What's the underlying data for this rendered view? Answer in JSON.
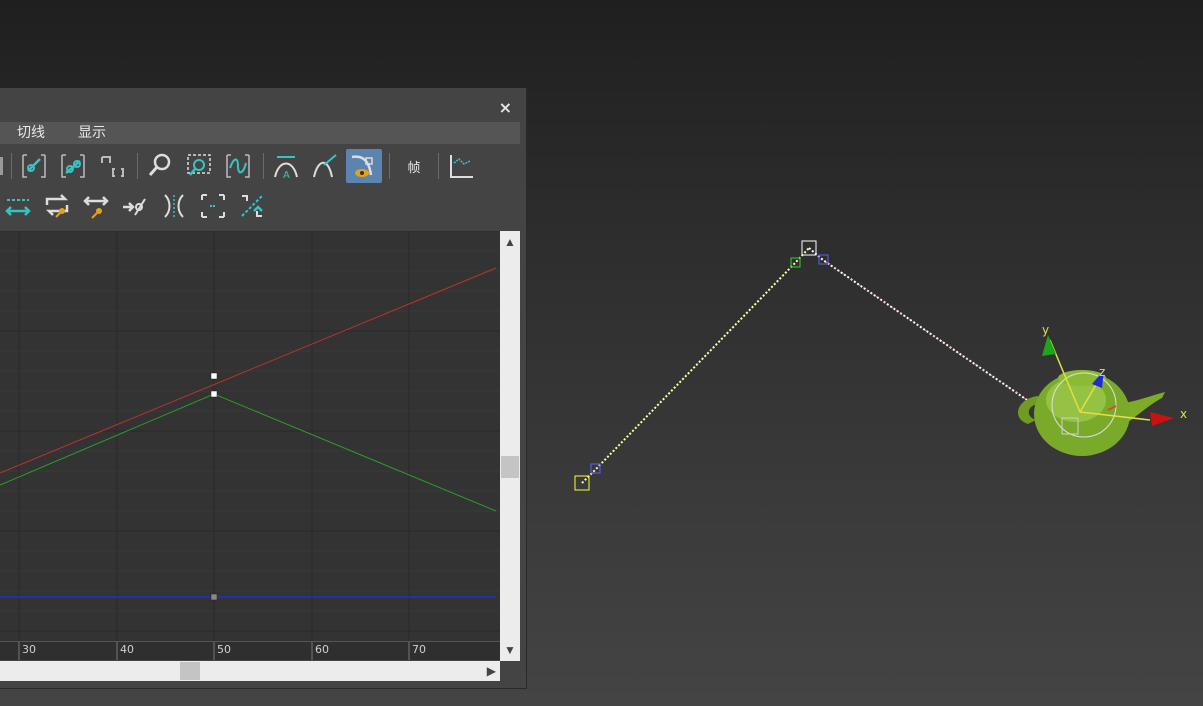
{
  "curve_editor": {
    "close_label": "×",
    "menu": [
      "切线",
      "显示"
    ],
    "frame_button_label": "帧",
    "ruler_ticks": [
      "30",
      "40",
      "50",
      "60",
      "70"
    ],
    "curve_colors": {
      "x": "#c03030",
      "y": "#2e9a2e",
      "z": "#2030b0"
    }
  },
  "scene": {
    "gizmo_axes": {
      "x": "x",
      "y": "y",
      "z": "z"
    },
    "trajectory_colors": {
      "path_a": "#ffff99",
      "path_b": "#ffffff"
    },
    "object": "teapot"
  },
  "toolbar_icons": {
    "row1": [
      "filter-keys-icon",
      "move-keys-icon",
      "slide-keys-icon",
      "zoom-icon",
      "zoom-region-icon",
      "curve-icon",
      "auto-tangent-icon",
      "tangent-icon",
      "show-tangents-icon",
      "frame-icon",
      "graph-icon"
    ],
    "row2": [
      "horizontal-move-icon",
      "loop-icon",
      "scale-keys-icon",
      "add-key-icon",
      "mirror-icon",
      "frame-region-icon",
      "normalize-icon"
    ]
  }
}
